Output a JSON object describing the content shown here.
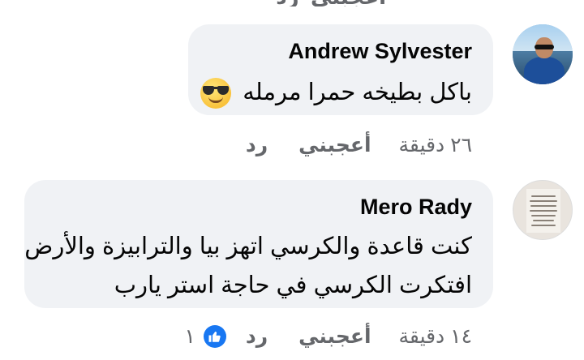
{
  "comments": [
    {
      "author": "Andrew Sylvester",
      "text": "باكل بطيخه حمرا مرمله",
      "emoji": "smiling-face-with-sunglasses",
      "time": "٢٦ دقيقة",
      "like_label": "أعجبني",
      "reply_label": "رد"
    },
    {
      "author": "Mero Rady",
      "lines": [
        "كنت قاعدة والكرسي اتهز بيا والترابيزة والأرض",
        "افتكرت الكرسي في حاجة استر يارب"
      ],
      "time": "١٤ دقيقة",
      "like_label": "أعجبني",
      "reply_label": "رد",
      "reaction": {
        "icon": "thumbs-up-icon",
        "count": "١",
        "color": "#1877f2"
      }
    }
  ],
  "colors": {
    "bubble": "#f0f2f5",
    "meta": "#65676b",
    "text": "#050505"
  }
}
